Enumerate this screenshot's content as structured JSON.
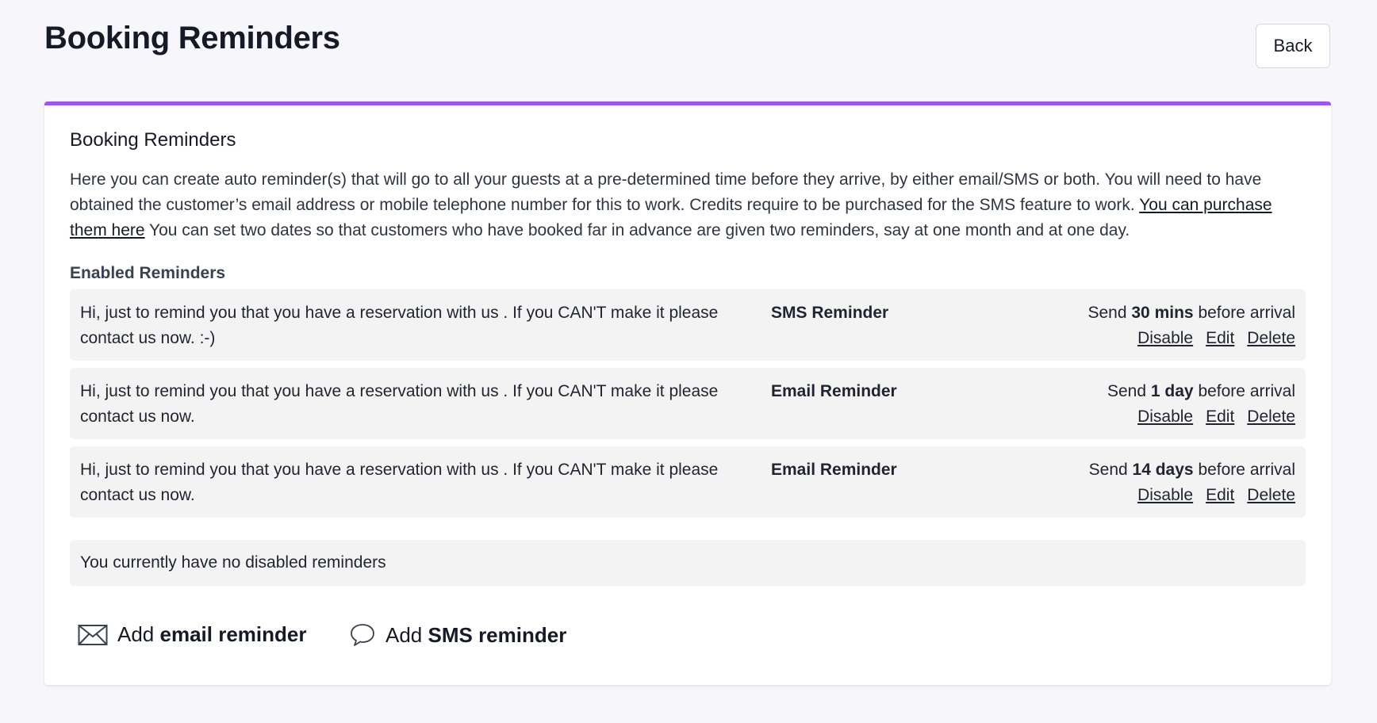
{
  "page": {
    "title": "Booking Reminders",
    "back_label": "Back"
  },
  "card": {
    "title": "Booking Reminders",
    "intro_text": "Here you can create auto reminder(s) that will go to all your guests at a pre-determined time before they arrive, by either email/SMS or both. You will need to have obtained the customer’s email address or mobile telephone number for this to work. Credits require to be purchased for the SMS feature to work. ",
    "purchase_link": "You can purchase them here",
    "intro_text_after": " You can set two dates so that customers who have booked far in advance are given two reminders, say at one month and at one day.",
    "enabled_label": "Enabled Reminders"
  },
  "reminders": [
    {
      "message": "Hi, just to remind you that you have a reservation with us . If you CAN'T make it please contact us now. :-)",
      "type": "SMS Reminder",
      "send_prefix": "Send",
      "send_value": "30 mins",
      "send_suffix": "before arrival",
      "actions": [
        "Disable",
        "Edit",
        "Delete"
      ]
    },
    {
      "message": "Hi, just to remind you that you have a reservation with us . If you CAN'T make it please contact us now.",
      "type": "Email Reminder",
      "send_prefix": "Send",
      "send_value": "1 day",
      "send_suffix": "before arrival",
      "actions": [
        "Disable",
        "Edit",
        "Delete"
      ]
    },
    {
      "message": "Hi, just to remind you that you have a reservation with us . If you CAN'T make it please contact us now.",
      "type": "Email Reminder",
      "send_prefix": "Send",
      "send_value": "14 days",
      "send_suffix": "before arrival",
      "actions": [
        "Disable",
        "Edit",
        "Delete"
      ]
    }
  ],
  "disabled": {
    "empty_text": "You currently have no disabled reminders"
  },
  "add": {
    "email_prefix": "Add",
    "email_bold": "email reminder",
    "sms_prefix": "Add",
    "sms_bold": "SMS reminder",
    "email_icon": "envelope-icon",
    "sms_icon": "speech-bubble-icon"
  },
  "colors": {
    "accent": "#9b59e8",
    "background": "#f7f7fb",
    "row_background": "#f3f3f3"
  }
}
